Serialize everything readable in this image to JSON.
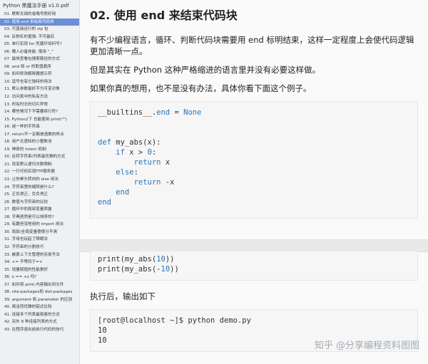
{
  "sidebar": {
    "title": "Python 黑魔法手册 v1.0.pdf",
    "items": [
      "01. 默默无闻的省略号很好用",
      "02. 使用 end 来结束代码块",
      "03. 可直接运行的 zip 包",
      "04. 反斜杠的倔强: 不可最后",
      "05. 单行实现 for 死循环如何写?",
      "06. 懒人必备技能: 使用 \"_\"",
      "07. 最快查看包搜索路径的方式",
      "08. and 和 or 的取值顺序",
      "09. 如何修改解释器提示符",
      "10. 逗号也有它独特的用法",
      "11. 默认参数最好不为可变对象",
      "12. 访问类中的私有方法",
      "13. 时有时无的切片异常",
      "14. 哪些情况下不需要续行符?",
      "15. Python2下 也能使用 print(\"\")",
      "16. 迷一样的字符串",
      "17. return不一定都是函数的终点",
      "18. 用户无感知的小整数池",
      "19. 神奇的 intern 机制",
      "20. 反转字符串/列表最优雅的方式",
      "21. 改变默认递归次数限制",
      "22. 一行代码实现FTP服务器",
      "23. 让你晕头转向的 else 用法",
      "24. 字符串里的缝隙是什么?",
      "25. 正负得正，负负得正",
      "26. 数值与字符串的比较",
      "27. 循环中的局部变量泄露",
      "28. 字典居然是可以排序的?",
      "29. 有趣但没啥用的 import 用法",
      "30. 局部/全局变量傻傻分不清",
      "31. 字母也玩起了障眼法",
      "32. 字符串的分割技巧",
      "33. 嵌套上下文管理的另类写法",
      "34. += 不等同于=+",
      "35. 增量赋值的性能更好",
      "36. x == +x 吗?",
      "37. 如何将 print 内容输出到文件",
      "38. site-packages和 dist-packages",
      "39. argument 和 parameter 的区别",
      "40. 简洁而优雅的链式比较",
      "41. 连接多个列表最极客的方式",
      "42. 另外 8 种连接列表的方式",
      "43. 在程序退出前执行代码的技巧"
    ],
    "active_index": 1
  },
  "main": {
    "heading": "02. 使用 end 来结束代码块",
    "para1": "有不少编程语言，循环、判断代码块需要用 end 标明结束，这样一定程度上会使代码逻辑更加清晰一点。",
    "para2": "但是其实在 Python 这种严格缩进的语言里并没有必要这样做。",
    "para3": "如果你真的想用，也不是没有办法，具体你看下面这个例子。",
    "code1_lines": [
      "__builtins__.end = None",
      "",
      "",
      "def my_abs(x):",
      "    if x > 0:",
      "        return x",
      "    else:",
      "        return -x",
      "    end",
      "end"
    ],
    "code2_lines": [
      "print(my_abs(10))",
      "print(my_abs(-10))"
    ],
    "para4": "执行后，输出如下",
    "code3_lines": [
      "[root@localhost ~]$ python demo.py",
      "10",
      "10"
    ]
  },
  "watermark": "知乎 @分享编程资料图图"
}
